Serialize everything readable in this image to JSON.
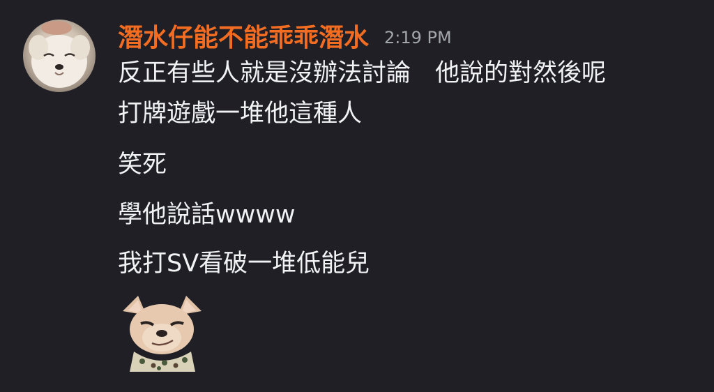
{
  "message": {
    "author": "潛水仔能不能乖乖潛水",
    "timestamp": "2:19 PM",
    "author_color": "#f26d21",
    "lines": [
      "反正有些人就是沒辦法討論　他說的對然後呢",
      "打牌遊戲一堆他這種人",
      "笑死",
      "學他說話wwww",
      "我打SV看破一堆低能兒"
    ]
  },
  "avatar_icon": "dog-avatar",
  "sticker_icon": "smirking-chihuahua-sticker"
}
